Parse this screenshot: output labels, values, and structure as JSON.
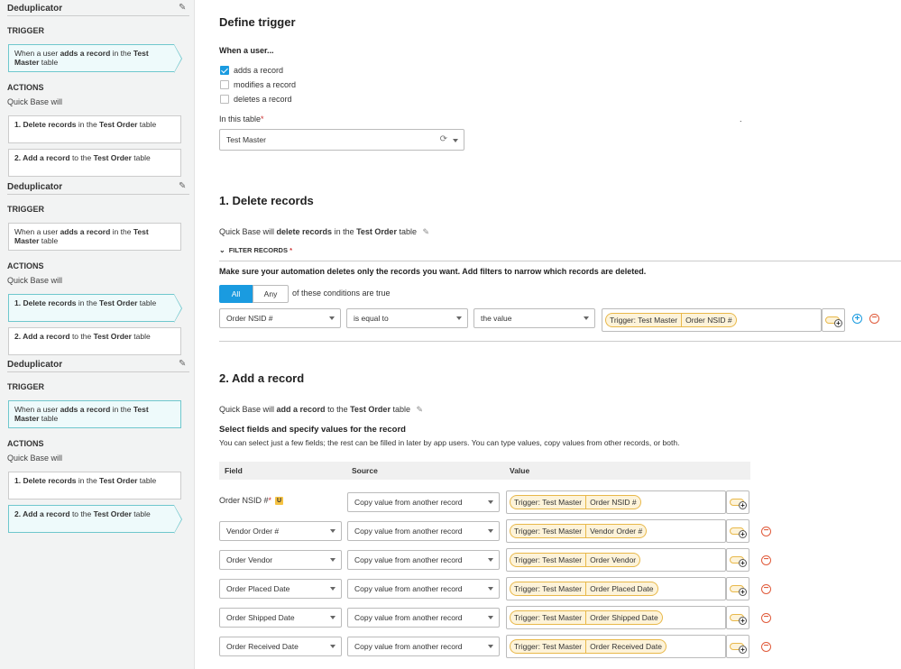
{
  "sidebar": {
    "groups": [
      {
        "title": "Deduplicator",
        "trigger_label": "TRIGGER",
        "trigger_card": {
          "p1": "When a user ",
          "b1": "adds a record",
          "p2": " in the ",
          "b2": "Test Master",
          "p3": " table"
        },
        "actions_label": "ACTIONS",
        "actions_sub": "Quick Base will",
        "actions": [
          {
            "num": "1. Delete records",
            "p1": " in the ",
            "b1": "Test Order",
            "p2": " table"
          },
          {
            "num": "2. Add a record",
            "p1": " to the ",
            "b1": "Test Order",
            "p2": " table"
          }
        ]
      },
      {
        "title": "Deduplicator",
        "trigger_label": "TRIGGER",
        "trigger_card": {
          "p1": "When a user ",
          "b1": "adds a record",
          "p2": " in the ",
          "b2": "Test Master",
          "p3": " table"
        },
        "actions_label": "ACTIONS",
        "actions_sub": "Quick Base will",
        "actions": [
          {
            "num": "1. Delete records",
            "p1": " in the ",
            "b1": "Test Order",
            "p2": " table"
          },
          {
            "num": "2. Add a record",
            "p1": " to the ",
            "b1": "Test Order",
            "p2": " table"
          }
        ]
      },
      {
        "title": "Deduplicator",
        "trigger_label": "TRIGGER",
        "trigger_card": {
          "p1": "When a user ",
          "b1": "adds a record",
          "p2": " in the ",
          "b2": "Test Master",
          "p3": " table"
        },
        "actions_label": "ACTIONS",
        "actions_sub": "Quick Base will",
        "actions": [
          {
            "num": "1. Delete records",
            "p1": " in the ",
            "b1": "Test Order",
            "p2": " table"
          },
          {
            "num": "2. Add a record",
            "p1": " to the ",
            "b1": "Test Order",
            "p2": " table"
          }
        ]
      }
    ]
  },
  "trigger": {
    "heading": "Define trigger",
    "when_label": "When a user...",
    "options": [
      {
        "label": "adds a record",
        "checked": true
      },
      {
        "label": "modifies a record",
        "checked": false
      },
      {
        "label": "deletes a record",
        "checked": false
      }
    ],
    "table_label": "In this table",
    "table_value": "Test Master",
    "dot": "."
  },
  "delete": {
    "heading": "1. Delete records",
    "desc_p1": "Quick Base will ",
    "desc_b1": "delete records",
    "desc_p2": " in the ",
    "desc_b2": "Test Order",
    "desc_p3": " table",
    "filter_label": "FILTER RECORDS",
    "instruction": "Make sure your automation deletes only the records you want. Add filters to narrow which records are deleted.",
    "tab_all": "All",
    "tab_any": "Any",
    "conditions_text": "of these conditions are true",
    "condition": {
      "field": "Order NSID #",
      "operator": "is equal to",
      "type": "the value",
      "pill_source": "Trigger: Test Master",
      "pill_field": "Order NSID #"
    }
  },
  "add": {
    "heading": "2. Add a record",
    "desc_p1": "Quick Base will ",
    "desc_b1": "add a record",
    "desc_p2": " to the ",
    "desc_b2": "Test Order",
    "desc_p3": " table",
    "select_title": "Select fields and specify values for the record",
    "select_sub": "You can select just a few fields; the rest can be filled in later by app users. You can type values, copy values from other records, or both.",
    "col_field": "Field",
    "col_source": "Source",
    "col_value": "Value",
    "first_field": "Order NSID #",
    "u_badge": "U",
    "rows": [
      {
        "field": "Order NSID #",
        "source": "Copy value from another record",
        "pill_source": "Trigger: Test Master",
        "pill_field": "Order NSID #"
      },
      {
        "field": "Vendor Order #",
        "source": "Copy value from another record",
        "pill_source": "Trigger: Test Master",
        "pill_field": "Vendor Order #"
      },
      {
        "field": "Order Vendor",
        "source": "Copy value from another record",
        "pill_source": "Trigger: Test Master",
        "pill_field": "Order Vendor"
      },
      {
        "field": "Order Placed Date",
        "source": "Copy value from another record",
        "pill_source": "Trigger: Test Master",
        "pill_field": "Order Placed Date"
      },
      {
        "field": "Order Shipped Date",
        "source": "Copy value from another record",
        "pill_source": "Trigger: Test Master",
        "pill_field": "Order Shipped Date"
      },
      {
        "field": "Order Received Date",
        "source": "Copy value from another record",
        "pill_source": "Trigger: Test Master",
        "pill_field": "Order Received Date"
      }
    ]
  },
  "icons": {
    "pencil": "pencil-icon",
    "caret": "chevron-down-icon",
    "refresh": "refresh-icon",
    "plus": "plus-icon",
    "minus": "minus-icon"
  },
  "colors": {
    "accent": "#1a9be0",
    "pill_bg": "#fdf3d9",
    "pill_border": "#e8b84a",
    "danger": "#e05a3a",
    "active_card": "#6fc7cd"
  }
}
